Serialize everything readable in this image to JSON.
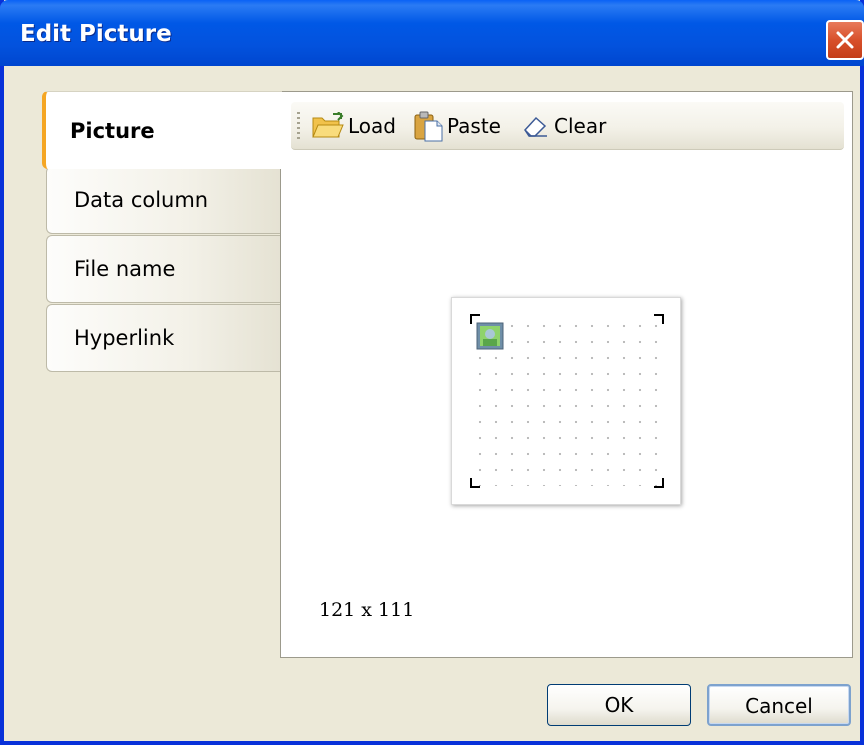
{
  "window": {
    "title": "Edit Picture"
  },
  "tabs": [
    {
      "label": "Picture",
      "active": true
    },
    {
      "label": "Data column",
      "active": false
    },
    {
      "label": "File name",
      "active": false
    },
    {
      "label": "Hyperlink",
      "active": false
    }
  ],
  "toolbar": {
    "load_label": "Load",
    "paste_label": "Paste",
    "clear_label": "Clear"
  },
  "preview": {
    "size_text": "121 x 111"
  },
  "buttons": {
    "ok_label": "OK",
    "cancel_label": "Cancel"
  },
  "colors": {
    "titlebar": "#0058e6",
    "active_tab_accent": "#f5a623",
    "dialog_bg": "#ece9d8"
  },
  "icons": [
    "close-icon",
    "folder-open-icon",
    "paste-icon",
    "eraser-icon",
    "picture-icon"
  ]
}
